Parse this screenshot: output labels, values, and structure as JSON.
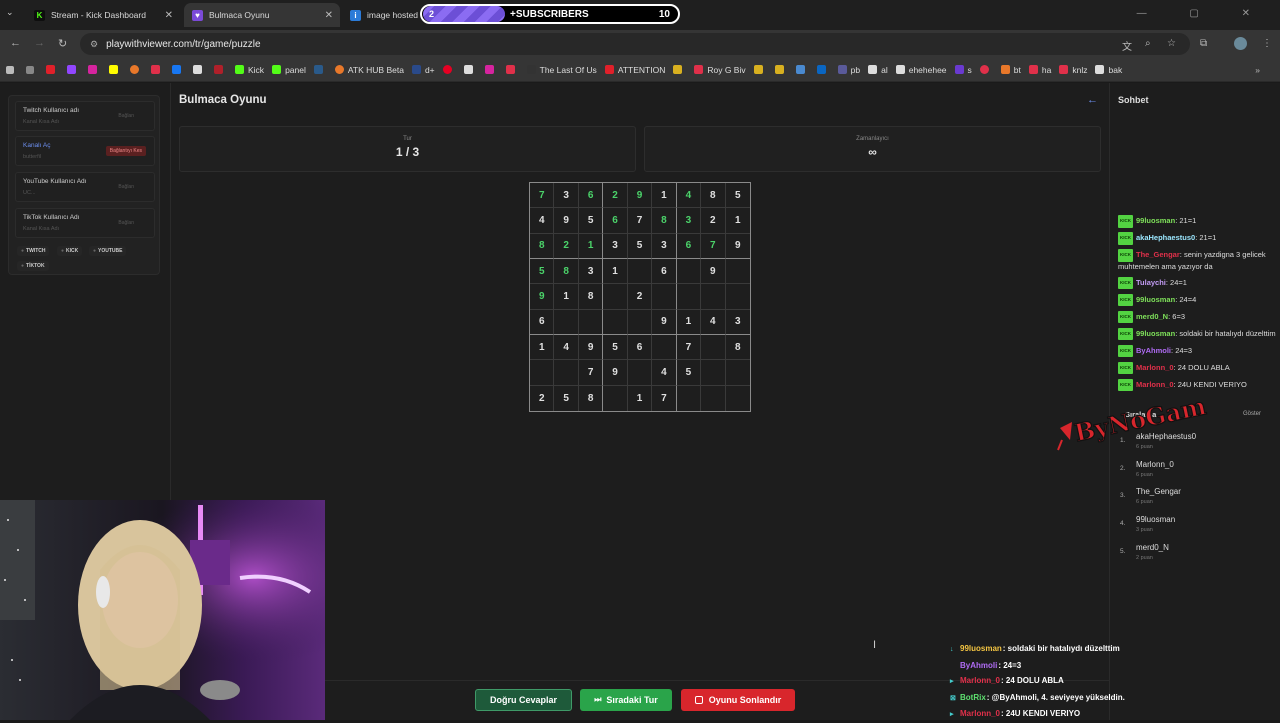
{
  "browser": {
    "tabs": [
      {
        "label": "Stream - Kick Dashboard",
        "icon": "kick-icon",
        "color": "#53fc18"
      },
      {
        "label": "Bulmaca Oyunu",
        "icon": "heart-icon",
        "color": "#b57cf2"
      },
      {
        "label": "image hosted a",
        "icon": "image-host-icon",
        "color": "#2b7bd8"
      }
    ],
    "url": "playwithviewer.com/tr/game/puzzle",
    "bookmarks": [
      "Kick",
      "panel",
      "ATK HUB Beta",
      "d+",
      "The Last Of Us",
      "ATTENTION",
      "Roy G Biv",
      "al",
      "pb",
      "al",
      "ehehehee",
      "s",
      "bt",
      "ha",
      "knlz",
      "bak"
    ]
  },
  "subs_widget": {
    "progress_label": "2",
    "label": "SUBSCRIBERS",
    "count": "10",
    "progress": 0.2
  },
  "left_panel": {
    "fields": [
      {
        "title": "Twitch Kullanıcı adı",
        "placeholder": "Kanal Kısa Adı",
        "button": "Bağlan"
      },
      {
        "title": "Kanalı Aç",
        "placeholder": "butterfil",
        "button": "Bağlantıyı Kes"
      },
      {
        "title": "YouTube Kullanıcı Adı",
        "placeholder": "UC...",
        "button": "Bağlan"
      },
      {
        "title": "TikTok Kullanıcı Adı",
        "placeholder": "Kanal Kısa Adı",
        "button": "Bağlan"
      }
    ],
    "platforms": [
      "TWITCH",
      "KICK",
      "YOUTUBE",
      "TİKTOK"
    ]
  },
  "game": {
    "title": "Bulmaca Oyunu",
    "round_label": "Tur",
    "round_value": "1 / 3",
    "timer_label": "Zamanlayıcı",
    "timer_value": "∞",
    "grid": [
      [
        "7",
        "3",
        "6",
        "2",
        "9",
        "1",
        "4",
        "8",
        "5"
      ],
      [
        "4",
        "9",
        "5",
        "6",
        "7",
        "8",
        "3",
        "2",
        "1"
      ],
      [
        "8",
        "2",
        "1",
        "3",
        "5",
        "3",
        "6",
        "7",
        "9"
      ],
      [
        "5",
        "8",
        "3",
        "1",
        "",
        "6",
        "",
        "9",
        ""
      ],
      [
        "9",
        "1",
        "8",
        "",
        "2",
        "",
        "",
        "",
        ""
      ],
      [
        "6",
        "",
        "",
        "",
        "",
        "9",
        "1",
        "4",
        "3"
      ],
      [
        "1",
        "4",
        "9",
        "5",
        "6",
        "",
        "7",
        "",
        "8"
      ],
      [
        "",
        "",
        "7",
        "9",
        "",
        "4",
        "5",
        "",
        ""
      ],
      [
        "2",
        "5",
        "8",
        "",
        "1",
        "7",
        "",
        "",
        ""
      ]
    ],
    "green": [
      [
        1,
        0,
        1,
        1,
        1,
        0,
        1,
        0,
        0
      ],
      [
        0,
        0,
        0,
        1,
        0,
        1,
        1,
        0,
        0
      ],
      [
        1,
        1,
        1,
        0,
        0,
        0,
        1,
        1,
        0
      ],
      [
        1,
        1,
        0,
        0,
        0,
        0,
        0,
        0,
        0
      ],
      [
        1,
        0,
        0,
        0,
        0,
        0,
        0,
        0,
        0
      ],
      [
        0,
        0,
        0,
        0,
        0,
        0,
        0,
        0,
        0
      ],
      [
        0,
        0,
        0,
        0,
        0,
        0,
        0,
        0,
        0
      ],
      [
        0,
        0,
        0,
        0,
        0,
        0,
        0,
        0,
        0
      ],
      [
        0,
        0,
        0,
        0,
        0,
        0,
        0,
        0,
        0
      ]
    ],
    "buttons": {
      "correct": "Doğru Cevaplar",
      "next": "Sıradaki Tur",
      "end": "Oyunu Sonlandır"
    }
  },
  "chat": {
    "title": "Sohbet",
    "messages": [
      {
        "user": "99luosman",
        "text": "21=1",
        "color": "#7ee05a"
      },
      {
        "user": "akaHephaestus0",
        "text": "21=1",
        "color": "#9be7ff"
      },
      {
        "user": "The_Gengar",
        "text": "senin yazdigna 3 gelicek muhtemelen ama yazıyor da",
        "color": "#e0304a"
      },
      {
        "user": "Tulaychi",
        "text": "24=1",
        "color": "#c39cf5"
      },
      {
        "user": "99luosman",
        "text": "24=4",
        "color": "#7ee05a"
      },
      {
        "user": "merd0_N",
        "text": "6=3",
        "color": "#7ee05a"
      },
      {
        "user": "99luosman",
        "text": "soldaki bir hatalıydı düzelttim",
        "color": "#7ee05a"
      },
      {
        "user": "ByAhmoli",
        "text": "24=3",
        "color": "#b06cf5"
      },
      {
        "user": "Marlonn_0",
        "text": "24 DOLU ABLA",
        "color": "#e0304a"
      },
      {
        "user": "Marlonn_0",
        "text": "24U KENDI VERIYO",
        "color": "#e0304a"
      }
    ],
    "badge": "KICK"
  },
  "ranking": {
    "title": "Sıralama",
    "show_label": "Göster",
    "rows": [
      {
        "rank": "1.",
        "name": "akaHephaestus0",
        "points": "6 puan"
      },
      {
        "rank": "2.",
        "name": "Marlonn_0",
        "points": "6 puan"
      },
      {
        "rank": "3.",
        "name": "The_Gengar",
        "points": "6 puan"
      },
      {
        "rank": "4.",
        "name": "99luosman",
        "points": "3 puan"
      },
      {
        "rank": "5.",
        "name": "merd0_N",
        "points": "2 puan"
      }
    ]
  },
  "overlay": {
    "logo_text": "ByNoGam",
    "chat": [
      {
        "user": "99luosman",
        "text": ": soldaki bir hatalıydı düzelttim",
        "color": "#f4c542"
      },
      {
        "user": "ByAhmoli",
        "text": ": 24=3",
        "color": "#b06cf5"
      },
      {
        "user": "Marlonn_0",
        "text": ": 24 DOLU ABLA",
        "color": "#e0304a"
      },
      {
        "user": "BotRix",
        "text": ": @ByAhmoli, 4. seviyeye yükseldin.",
        "color": "#5ee070"
      },
      {
        "user": "Marlonn_0",
        "text": ": 24U KENDI VERIYO",
        "color": "#e0304a"
      }
    ]
  }
}
